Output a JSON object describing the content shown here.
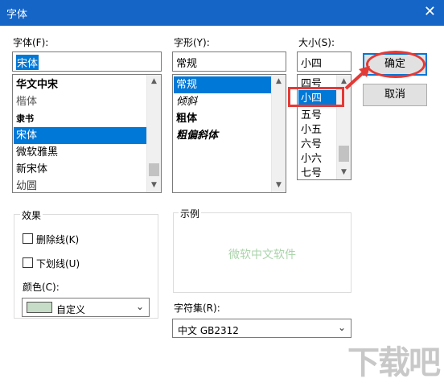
{
  "window": {
    "title": "字体",
    "close": "✕"
  },
  "font": {
    "label": "字体(F):",
    "value": "宋体",
    "items": [
      "华文中宋",
      "楷体",
      "隶书",
      "宋体",
      "微软雅黑",
      "新宋体",
      "幼圆"
    ]
  },
  "style": {
    "label": "字形(Y):",
    "value": "常规",
    "items": [
      "常规",
      "倾斜",
      "粗体",
      "粗偏斜体"
    ]
  },
  "size": {
    "label": "大小(S):",
    "value": "小四",
    "items": [
      "四号",
      "小四",
      "五号",
      "小五",
      "六号",
      "小六",
      "七号"
    ]
  },
  "buttons": {
    "ok": "确定",
    "cancel": "取消"
  },
  "effects": {
    "label": "效果",
    "strikeout": "删除线(K)",
    "underline": "下划线(U)",
    "color_label": "颜色(C):",
    "color_value": "自定义",
    "color_swatch": "#c6dcc6"
  },
  "sample": {
    "label": "示例",
    "text": "微软中文软件"
  },
  "charset": {
    "label": "字符集(R):",
    "value": "中文 GB2312"
  },
  "watermark": "下载吧",
  "colors": {
    "accent": "#0078d7",
    "annotation": "#e53935",
    "titlebar": "#1565c6"
  }
}
